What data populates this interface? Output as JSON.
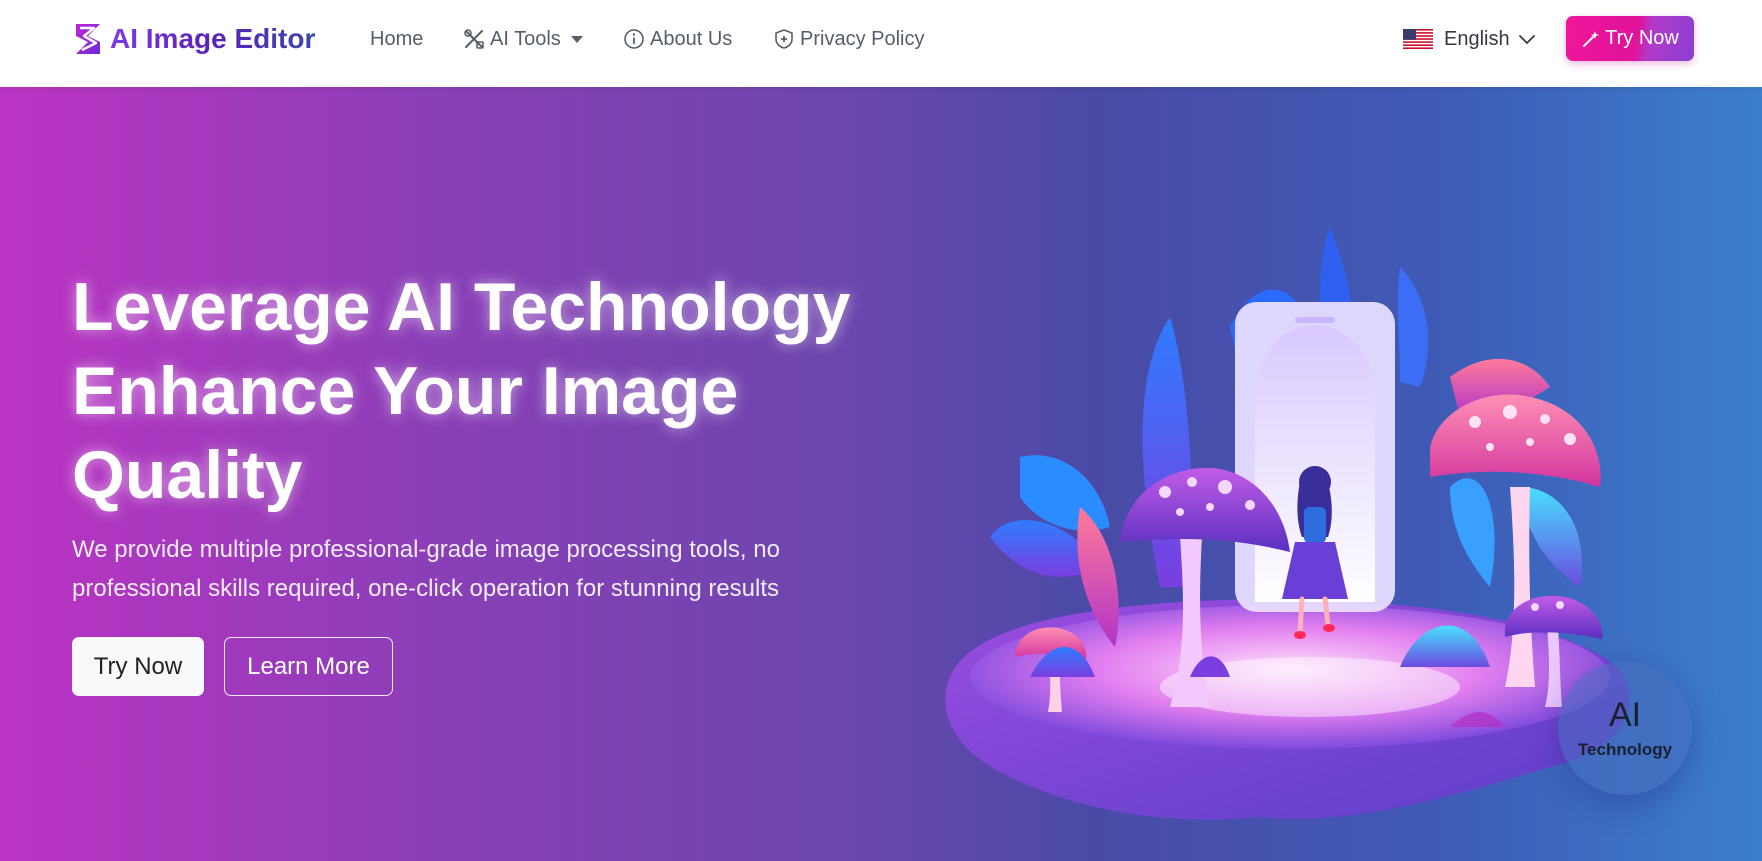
{
  "brand": {
    "name": "AI Image Editor",
    "logo_icon": "brand-s-logo-icon"
  },
  "nav": {
    "home": "Home",
    "ai_tools": "AI Tools",
    "about": "About Us",
    "privacy": "Privacy Policy",
    "language": "English",
    "try_now": "Try Now"
  },
  "hero": {
    "title_lines": [
      "Leverage AI Technology",
      "Enhance Your Image",
      "Quality"
    ],
    "subtitle": "We provide multiple professional-grade image processing tools, no professional skills required, one-click operation for stunning results",
    "primary_button": "Try Now",
    "secondary_button": "Learn More",
    "badge_title": "AI",
    "badge_subtitle": "Technology"
  },
  "colors": {
    "accent_pink": "#f0169b",
    "hero_gradient_start": "#bb33c3",
    "hero_gradient_end": "#3b7fcd",
    "nav_text": "#555e6b"
  }
}
